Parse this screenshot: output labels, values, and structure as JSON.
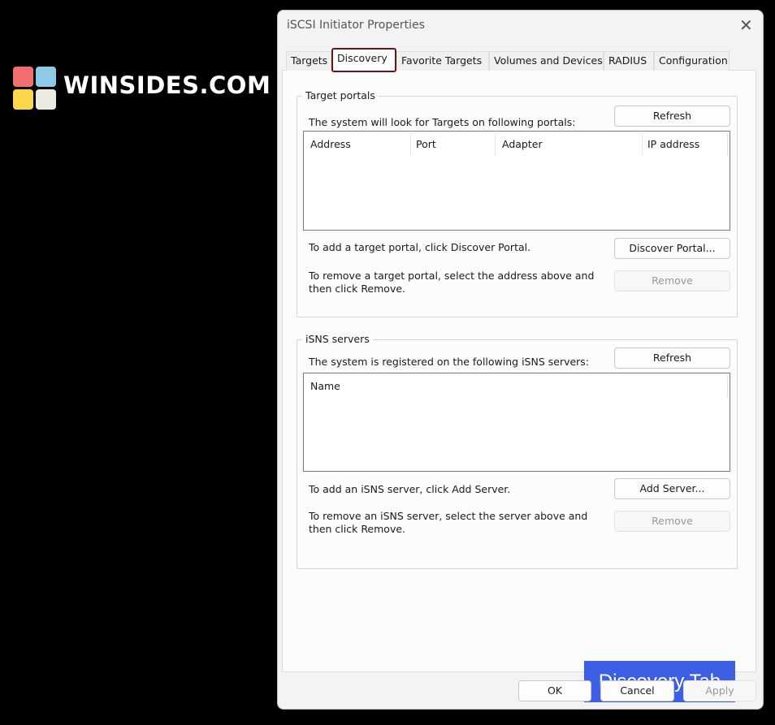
{
  "brand": {
    "name": "WINSIDES.COM",
    "colors": [
      "#f26d6d",
      "#8fc9e8",
      "#fbd54a",
      "#ecebe2"
    ]
  },
  "dialog": {
    "title": "iSCSI Initiator Properties",
    "close_icon": "close-icon",
    "tabs": [
      {
        "label": "Targets"
      },
      {
        "label": "Discovery",
        "selected": true
      },
      {
        "label": "Favorite Targets"
      },
      {
        "label": "Volumes and Devices"
      },
      {
        "label": "RADIUS"
      },
      {
        "label": "Configuration"
      }
    ],
    "target_portals": {
      "label": "Target portals",
      "description": "The system will look for Targets on following portals:",
      "refresh": "Refresh",
      "columns": [
        "Address",
        "Port",
        "Adapter",
        "IP address"
      ],
      "rows": [],
      "add_text": "To add a target portal, click Discover Portal.",
      "discover": "Discover Portal...",
      "remove_text": "To remove a target portal, select the address above and then click Remove.",
      "remove": "Remove"
    },
    "isns": {
      "label": "iSNS servers",
      "description": "The system is registered on the following iSNS servers:",
      "refresh": "Refresh",
      "columns": [
        "Name"
      ],
      "rows": [],
      "add_text": "To add an iSNS server, click Add Server.",
      "add": "Add Server...",
      "remove_text": "To remove an iSNS server, select the server above and then click Remove.",
      "remove": "Remove"
    },
    "footer": {
      "ok": "OK",
      "cancel": "Cancel",
      "apply": "Apply"
    }
  },
  "callout": {
    "text": "Discovery Tab",
    "color": "#3d5fe6"
  }
}
